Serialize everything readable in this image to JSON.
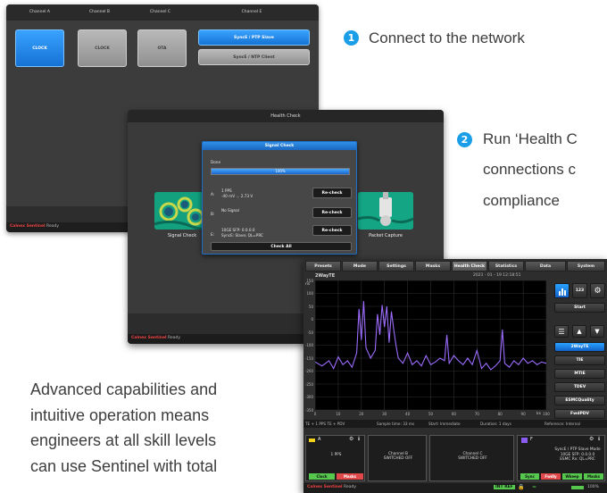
{
  "screen1": {
    "channels": [
      {
        "label": "Channel A",
        "tile": "CLOCK"
      },
      {
        "label": "Channel B",
        "tile": "CLOCK"
      },
      {
        "label": "Channel C",
        "tile": "OTA"
      },
      {
        "label": "Channel E",
        "tile_primary": "SyncE / PTP Slave",
        "tile_secondary": "SyncE / NTP Client"
      }
    ],
    "brand": "Calnex Sentinel",
    "status": "Ready"
  },
  "callouts": [
    {
      "number": "1",
      "lines": [
        "Connect to the network"
      ]
    },
    {
      "number": "2",
      "lines": [
        "Run ‘Health C",
        "connections c",
        "compliance"
      ]
    }
  ],
  "screen2": {
    "title": "Health Check",
    "signal_check_caption": "Signal Check",
    "packet_capture_caption": "Packet Capture",
    "brand": "Calnex Sentinel",
    "status": "Ready",
    "dialog": {
      "title": "Signal Check",
      "state": "Done",
      "progress": 1.0,
      "progress_label": "100%",
      "rows": [
        {
          "letter": "A:",
          "line1": "1 PPS",
          "line2": "-40 mV ... 2.73 V",
          "button": "Re-check"
        },
        {
          "letter": "B:",
          "line1": "No Signal",
          "line2": "",
          "button": "Re-check"
        },
        {
          "letter": "E:",
          "line1": "10GE SFP: 0.0.0.0",
          "line2": "SyncE: Slave; QL=PRC",
          "button": "Re-check"
        }
      ],
      "check_all": "Check All"
    }
  },
  "screen3": {
    "tabs": [
      "Presets",
      "Mode",
      "Settings",
      "Masks",
      "Health Check",
      "Statistics",
      "Data",
      "System"
    ],
    "active_tab": "Health Check",
    "plot_title": "2WayTE",
    "timestamp": "2021 - 01 - 19 12:18:51",
    "y_unit": "ns",
    "x_unit": "ks",
    "y_ticks": [
      "150",
      "100",
      "50",
      "0",
      "-50",
      "-100",
      "-150",
      "-200",
      "-250",
      "-300",
      "-350"
    ],
    "x_ticks": [
      "0",
      "10",
      "20",
      "30",
      "40",
      "50",
      "60",
      "70",
      "80",
      "90",
      "100"
    ],
    "footer": {
      "trace": "TE + 1 PPS TE + PDV",
      "sample": "Sample time: 33 ms",
      "start": "Start: Immediate",
      "duration": "Duration: 1 days",
      "reference": "Reference: Internal"
    },
    "side": {
      "icon_label": "123",
      "start": "Start",
      "metrics": [
        "2WayTE",
        "TIE",
        "MTIE",
        "TDEV",
        "ESMCQuality",
        "FwdPDV"
      ],
      "selected": "2WayTE"
    },
    "panels": [
      {
        "label": "A",
        "text": "1 PPS",
        "chips": [
          "Clock",
          "Masks"
        ]
      },
      {
        "label": "",
        "text": "Channel B\nSWITCHED OFF",
        "chips": []
      },
      {
        "label": "",
        "text": "Channel C\nSWITCHED OFF",
        "chips": []
      },
      {
        "label": "F",
        "text": "SyncE / PTP Slave Mode\n10GE SFP: 0.0.0.0\nESMC Rx: QL=PRC",
        "chips": [
          "Sync",
          "Fwdly",
          "Wkeep",
          "Masks"
        ]
      }
    ],
    "brand": "Calnex Sentinel",
    "status": "Ready",
    "status_right": [
      "INT REF",
      "100%"
    ]
  },
  "marketing": {
    "lines": [
      "Advanced capabilities and",
      "intuitive operation means",
      "engineers at all skill levels",
      "can use Sentinel with total"
    ]
  },
  "chart_data": {
    "type": "line",
    "title": "2WayTE",
    "ylabel": "ns",
    "xlabel": "ks",
    "ylim": [
      -350,
      150
    ],
    "xlim": [
      0,
      100
    ],
    "grid": true,
    "series": [
      {
        "x": [
          0,
          3,
          6,
          8,
          10,
          12,
          14,
          16,
          18,
          19,
          20,
          21,
          22,
          24,
          26,
          27,
          28,
          29,
          30,
          31,
          32,
          33,
          34,
          35,
          36,
          38,
          40,
          42,
          44,
          46,
          48,
          50,
          52,
          54,
          56,
          57,
          58,
          60,
          62,
          64,
          66,
          68,
          70,
          72,
          74,
          76,
          78,
          80,
          81,
          82,
          84,
          86,
          88,
          90,
          92,
          94,
          96,
          98,
          100
        ],
        "y": [
          -165,
          -180,
          -160,
          -190,
          -145,
          -175,
          -160,
          -185,
          -130,
          40,
          -80,
          70,
          -110,
          -150,
          -120,
          20,
          -60,
          55,
          -30,
          50,
          -90,
          30,
          -40,
          -100,
          -150,
          -170,
          -130,
          -175,
          -160,
          -180,
          -140,
          -175,
          -165,
          -150,
          -160,
          -60,
          -170,
          -140,
          -160,
          -175,
          -150,
          -175,
          -120,
          -190,
          -170,
          -195,
          -180,
          -160,
          -40,
          -170,
          -185,
          -160,
          -175,
          -150,
          -170,
          -160,
          -175,
          -165,
          -170
        ]
      }
    ]
  }
}
